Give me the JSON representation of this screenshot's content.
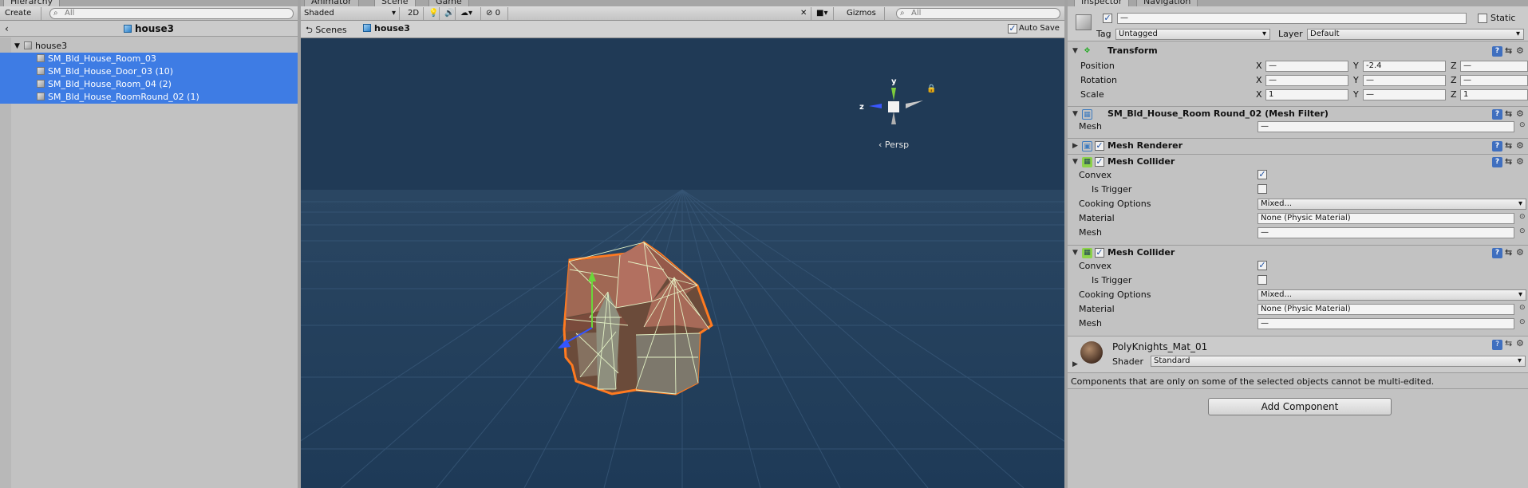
{
  "hierarchy": {
    "tab_label": "Hierarchy",
    "create_label": "Create",
    "search_placeholder": "All",
    "scene_title": "house3",
    "root": "house3",
    "items": [
      {
        "label": "SM_Bld_House_Room_03"
      },
      {
        "label": "SM_Bld_House_Door_03 (10)"
      },
      {
        "label": "SM_Bld_House_Room_04 (2)"
      },
      {
        "label": "SM_Bld_House_RoomRound_02 (1)"
      }
    ]
  },
  "scene": {
    "tabs": [
      "Animator",
      "Scene",
      "Game"
    ],
    "toolbar": {
      "shading": "Shaded",
      "mode_2d": "2D",
      "hidden_count": "0",
      "gizmos": "Gizmos",
      "search_placeholder": "All"
    },
    "breadcrumb": {
      "scenes": "Scenes",
      "current": "house3"
    },
    "auto_save": "Auto Save",
    "persp": "Persp",
    "axes": {
      "y": "y",
      "z": "z"
    }
  },
  "inspector": {
    "tabs": [
      "Inspector",
      "Navigation"
    ],
    "object_name": "—",
    "static_label": "Static",
    "tag_label": "Tag",
    "tag_value": "Untagged",
    "layer_label": "Layer",
    "layer_value": "Default",
    "transform": {
      "title": "Transform",
      "rows": [
        {
          "label": "Position",
          "x": "—",
          "y": "-2.4",
          "z": "—"
        },
        {
          "label": "Rotation",
          "x": "—",
          "y": "—",
          "z": "—"
        },
        {
          "label": "Scale",
          "x": "1",
          "y": "—",
          "z": "1"
        }
      ]
    },
    "mesh_filter": {
      "title": "SM_Bld_House_Room Round_02 (Mesh Filter)",
      "mesh_label": "Mesh",
      "mesh_value": "—"
    },
    "mesh_renderer": {
      "title": "Mesh Renderer"
    },
    "colliders": [
      {
        "title": "Mesh Collider",
        "convex_label": "Convex",
        "trigger_label": "Is Trigger",
        "cooking_label": "Cooking Options",
        "cooking_value": "Mixed...",
        "material_label": "Material",
        "material_value": "None (Physic Material)",
        "mesh_label": "Mesh",
        "mesh_value": "—"
      },
      {
        "title": "Mesh Collider",
        "convex_label": "Convex",
        "trigger_label": "Is Trigger",
        "cooking_label": "Cooking Options",
        "cooking_value": "Mixed...",
        "material_label": "Material",
        "material_value": "None (Physic Material)",
        "mesh_label": "Mesh",
        "mesh_value": "—"
      }
    ],
    "material": {
      "name": "PolyKnights_Mat_01",
      "shader_label": "Shader",
      "shader_value": "Standard"
    },
    "note": "Components that are only on some of the selected objects cannot be multi-edited.",
    "add_component": "Add Component"
  }
}
